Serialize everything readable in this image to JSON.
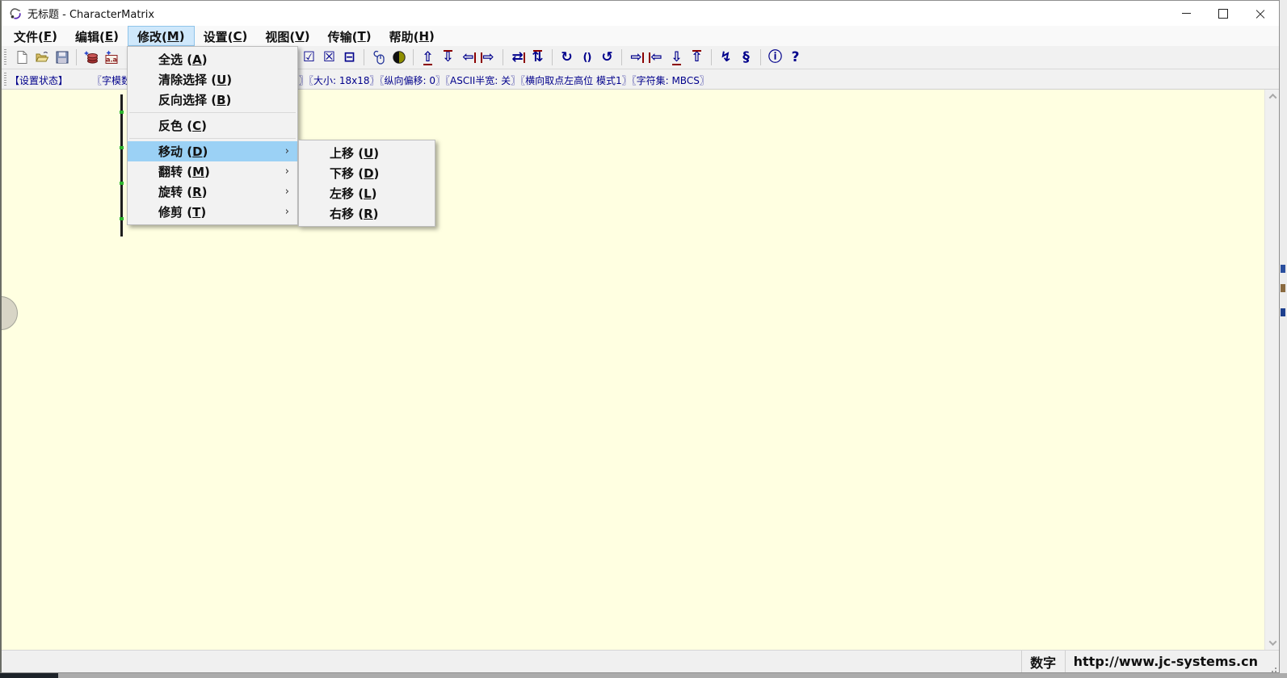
{
  "window": {
    "title": "无标题 - CharacterMatrix",
    "app_icon": "character-matrix-app-icon",
    "controls": [
      "minimize-icon",
      "maximize-icon",
      "close-icon"
    ]
  },
  "menubar": {
    "items": [
      {
        "label": "文件(F)",
        "active": false
      },
      {
        "label": "编辑(E)",
        "active": false
      },
      {
        "label": "修改(M)",
        "active": true
      },
      {
        "label": "设置(C)",
        "active": false
      },
      {
        "label": "视图(V)",
        "active": false
      },
      {
        "label": "传输(T)",
        "active": false
      },
      {
        "label": "帮助(H)",
        "active": false
      }
    ]
  },
  "toolbar": {
    "left_groups": [
      {
        "items": [
          {
            "name": "new-file-icon",
            "svg": "new"
          },
          {
            "name": "open-file-icon",
            "svg": "open"
          },
          {
            "name": "save-file-icon",
            "svg": "save"
          }
        ]
      },
      {
        "items": [
          {
            "name": "new-charset-icon",
            "svg": "stack"
          },
          {
            "name": "add-char-icon",
            "svg": "achar"
          },
          {
            "name": "add-plus-icon",
            "glyph": "+",
            "color": "#00a400"
          }
        ]
      }
    ],
    "right_groups": [
      {
        "items": [
          {
            "name": "select-all-icon",
            "glyph": "☑"
          },
          {
            "name": "clear-selection-icon",
            "glyph": "☒"
          },
          {
            "name": "invert-selection-icon",
            "glyph": "⊟"
          }
        ]
      },
      {
        "items": [
          {
            "name": "mouse-pick-icon",
            "svg": "mouse"
          },
          {
            "name": "invert-color-icon",
            "svg": "invert"
          }
        ]
      },
      {
        "items": [
          {
            "name": "move-up-icon",
            "glyph": "⇧",
            "accent": "bottom"
          },
          {
            "name": "move-down-icon",
            "glyph": "⇩",
            "accent": "top"
          },
          {
            "name": "move-left-icon",
            "glyph": "⇦",
            "accent": "right"
          },
          {
            "name": "move-right-icon",
            "glyph": "⇨",
            "accent": "left"
          }
        ]
      },
      {
        "items": [
          {
            "name": "flip-horizontal-icon",
            "glyph": "⇄",
            "accent": "right"
          },
          {
            "name": "flip-vertical-icon",
            "glyph": "⇅",
            "accent": "top"
          }
        ]
      },
      {
        "items": [
          {
            "name": "rotate-cw-icon",
            "glyph": "↻"
          },
          {
            "name": "rotate-180-icon",
            "glyph": "()",
            "small": true
          },
          {
            "name": "rotate-ccw-icon",
            "glyph": "↺"
          }
        ]
      },
      {
        "items": [
          {
            "name": "trim-right-icon",
            "glyph": "⇨",
            "accent": "right"
          },
          {
            "name": "trim-left-icon",
            "glyph": "⇦",
            "accent": "left"
          },
          {
            "name": "trim-bottom-icon",
            "glyph": "⇩",
            "accent": "bottom"
          },
          {
            "name": "trim-top-icon",
            "glyph": "⇧",
            "accent": "top"
          }
        ]
      },
      {
        "items": [
          {
            "name": "transmit-icon",
            "glyph": "↯"
          },
          {
            "name": "serial-icon",
            "glyph": "§"
          }
        ]
      },
      {
        "items": [
          {
            "name": "about-icon",
            "glyph": "ⓘ"
          },
          {
            "name": "help-icon",
            "glyph": "?"
          }
        ]
      }
    ]
  },
  "infobar": {
    "status_label": "【设置状态】",
    "partial_segment": "〖字模数",
    "segments": "〗〖大小: 18x18〗〖纵向偏移: 0〗〖ASCII半宽: 关〗〖横向取点左高位 模式1〗〖字符集: MBCS〗"
  },
  "modify_menu": {
    "items": [
      {
        "label": "全选 (A)",
        "submenu": false,
        "highlighted": false,
        "separator_after": false
      },
      {
        "label": "清除选择 (U)",
        "submenu": false,
        "highlighted": false,
        "separator_after": false
      },
      {
        "label": "反向选择 (B)",
        "submenu": false,
        "highlighted": false,
        "separator_after": true
      },
      {
        "label": "反色 (C)",
        "submenu": false,
        "highlighted": false,
        "separator_after": true
      },
      {
        "label": "移动 (D)",
        "submenu": true,
        "highlighted": true,
        "separator_after": false
      },
      {
        "label": "翻转 (M)",
        "submenu": true,
        "highlighted": false,
        "separator_after": false
      },
      {
        "label": "旋转 (R)",
        "submenu": true,
        "highlighted": false,
        "separator_after": false
      },
      {
        "label": "修剪 (T)",
        "submenu": true,
        "highlighted": false,
        "separator_after": false
      }
    ],
    "submenu_arrow": "›"
  },
  "move_submenu": {
    "items": [
      {
        "label": "上移 (U)"
      },
      {
        "label": "下移 (D)"
      },
      {
        "label": "左移 (L)"
      },
      {
        "label": "右移 (R)"
      }
    ]
  },
  "statusbar": {
    "field_digit": "数字",
    "field_url": "http://www.jc-systems.cn"
  },
  "colors": {
    "canvas_bg": "#ffffe1",
    "menu_highlight": "#9bd1f5",
    "menubar_highlight": "#cfe8fb",
    "icon_navy": "#00008b",
    "icon_darkred": "#8b0000"
  }
}
